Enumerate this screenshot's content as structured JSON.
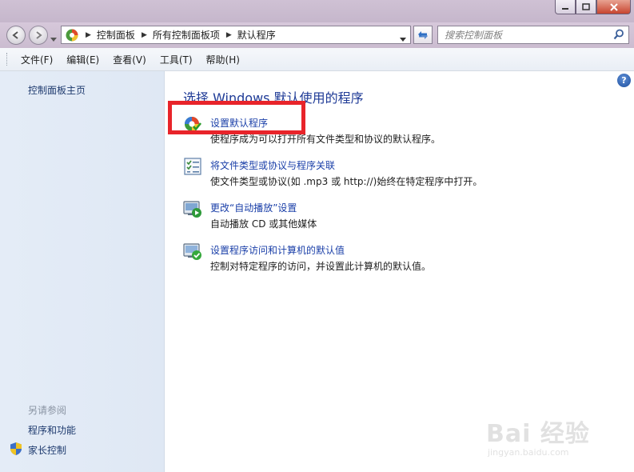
{
  "window": {
    "buttons": [
      "minimize",
      "maximize",
      "close"
    ]
  },
  "nav": {
    "breadcrumbs": [
      "控制面板",
      "所有控制面板项",
      "默认程序"
    ],
    "search_placeholder": "搜索控制面板"
  },
  "menu": [
    "文件(F)",
    "编辑(E)",
    "查看(V)",
    "工具(T)",
    "帮助(H)"
  ],
  "sidebar": {
    "home": "控制面板主页",
    "see_also": "另请参阅",
    "links": [
      "程序和功能",
      "家长控制"
    ]
  },
  "main": {
    "title": "选择 Windows 默认使用的程序",
    "help": "?",
    "tasks": [
      {
        "link": "设置默认程序",
        "desc": "使程序成为可以打开所有文件类型和协议的默认程序。",
        "icon": "default-programs-icon"
      },
      {
        "link": "将文件类型或协议与程序关联",
        "desc": "使文件类型或协议(如 .mp3 或 http://)始终在特定程序中打开。",
        "icon": "file-association-icon"
      },
      {
        "link": "更改“自动播放”设置",
        "desc": "自动播放 CD 或其他媒体",
        "icon": "autoplay-icon"
      },
      {
        "link": "设置程序访问和计算机的默认值",
        "desc": "控制对特定程序的访问，并设置此计算机的默认值。",
        "icon": "program-access-icon"
      }
    ]
  },
  "watermark": {
    "text": "Bai 经验",
    "sub": "jingyan.baidu.com"
  },
  "colors": {
    "link": "#1a3fa8",
    "title": "#1e3a96",
    "highlight": "#e8242a",
    "sidebar_bg": "#e4ecf7"
  }
}
